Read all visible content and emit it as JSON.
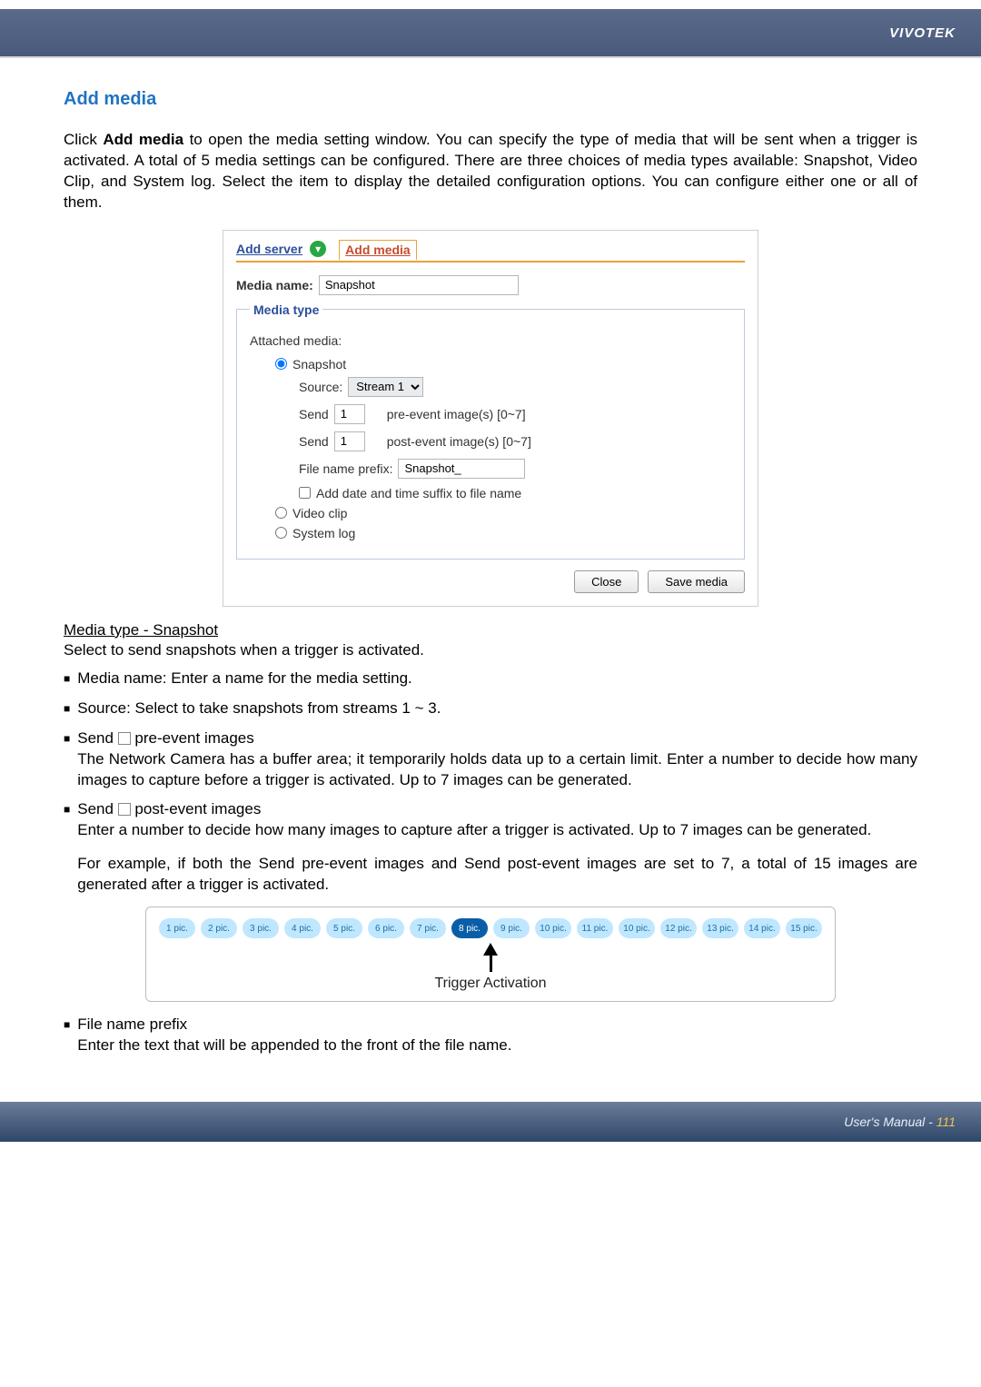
{
  "header": {
    "brand": "VIVOTEK"
  },
  "section": {
    "title": "Add media"
  },
  "intro": {
    "prefix": "Click ",
    "bold": "Add media",
    "rest": " to open the media setting window. You can specify the type of media that will be sent when a trigger is activated. A total of 5 media settings can be configured. There are three choices of media types available: Snapshot, Video Clip, and System log. Select the item to display the detailed configuration options. You can configure either one or all of them."
  },
  "panel": {
    "tabs": {
      "server": "Add server",
      "media": "Add media"
    },
    "media_name_label": "Media name:",
    "media_name_value": "Snapshot",
    "fieldset_legend": "Media type",
    "attached_label": "Attached media:",
    "radios": {
      "snapshot": "Snapshot",
      "video": "Video clip",
      "syslog": "System log"
    },
    "source_label": "Source:",
    "source_value": "Stream 1",
    "send_label": "Send",
    "pre_value": "1",
    "pre_suffix": "pre-event image(s) [0~7]",
    "post_value": "1",
    "post_suffix": "post-event image(s) [0~7]",
    "prefix_label": "File name prefix:",
    "prefix_value": "Snapshot_",
    "date_suffix_label": "Add date and time suffix to file name",
    "buttons": {
      "close": "Close",
      "save": "Save media"
    }
  },
  "snapshot_heading": "Media type - Snapshot",
  "snapshot_sub": "Select to send snapshots when a trigger is activated.",
  "bullets": {
    "b1": "Media name: Enter a name for the media setting.",
    "b2": "Source: Select to take snapshots from streams 1 ~ 3.",
    "b3_lead": "Send ",
    "b3_tail": " pre-event images",
    "b3_body": "The Network Camera has a buffer area; it temporarily holds data up to a certain limit. Enter a number to decide how many images to capture before a trigger is activated. Up to 7 images can be generated.",
    "b4_lead": "Send ",
    "b4_tail": " post-event images",
    "b4_body": "Enter a number to decide how many images to capture after a trigger is activated. Up to 7 images can be generated.",
    "b4_example": "For example, if both the Send pre-event images and Send post-event images are set to 7, a total of 15 images are generated after a trigger is activated.",
    "b5_head": "File name prefix",
    "b5_body": "Enter the text that will be appended to the front of the file name."
  },
  "chart_data": {
    "type": "bar",
    "categories": [
      "1 pic.",
      "2 pic.",
      "3 pic.",
      "4 pic.",
      "5 pic.",
      "6 pic.",
      "7 pic.",
      "8 pic.",
      "9 pic.",
      "10 pic.",
      "11 pic.",
      "10 pic.",
      "12 pic.",
      "13 pic.",
      "14 pic.",
      "15 pic."
    ],
    "trigger_index": 7,
    "trigger_label": "Trigger Activation",
    "title": "",
    "xlabel": "",
    "ylabel": ""
  },
  "footer": {
    "manual": "User's Manual - ",
    "page": "111"
  }
}
